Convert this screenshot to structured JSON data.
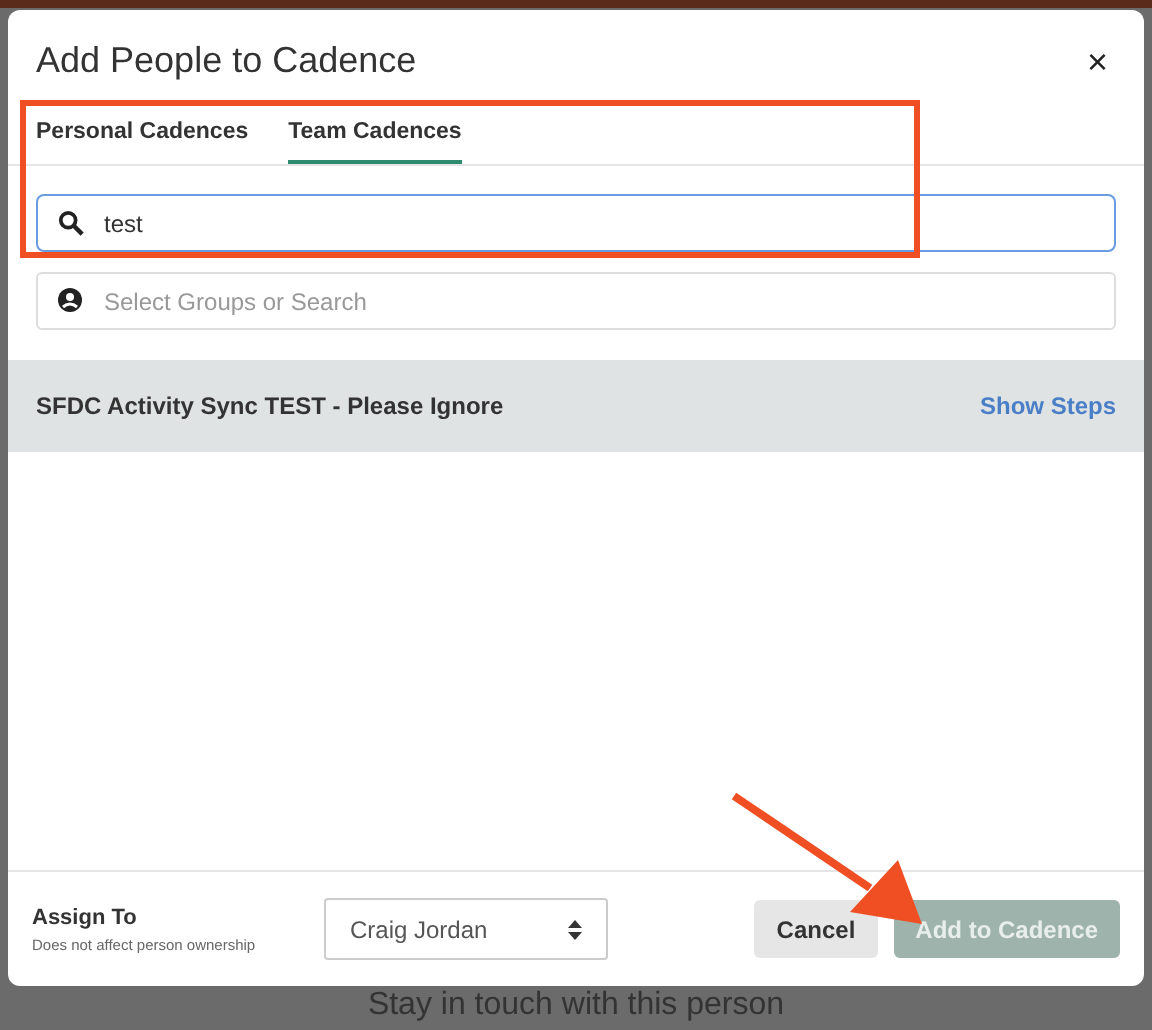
{
  "dialog": {
    "title": "Add People to Cadence",
    "close": "×"
  },
  "tabs": [
    {
      "label": "Personal Cadences",
      "selected": false
    },
    {
      "label": "Team Cadences",
      "selected": true
    }
  ],
  "search": {
    "value": "test"
  },
  "group_search": {
    "placeholder": "Select Groups or Search"
  },
  "results": [
    {
      "name": "SFDC Activity Sync TEST - Please Ignore",
      "action": "Show Steps",
      "selected": true
    }
  ],
  "footer": {
    "assign_label": "Assign To",
    "assign_hint": "Does not affect person ownership",
    "assignee": "Craig Jordan",
    "buttons": [
      {
        "label": "Cancel",
        "kind": "secondary",
        "disabled": false
      },
      {
        "label": "Add to Cadence",
        "kind": "primary",
        "disabled": true
      }
    ]
  },
  "annotations": {
    "highlight_box": true,
    "arrow": true
  },
  "background_text": "Stay in touch with this person"
}
